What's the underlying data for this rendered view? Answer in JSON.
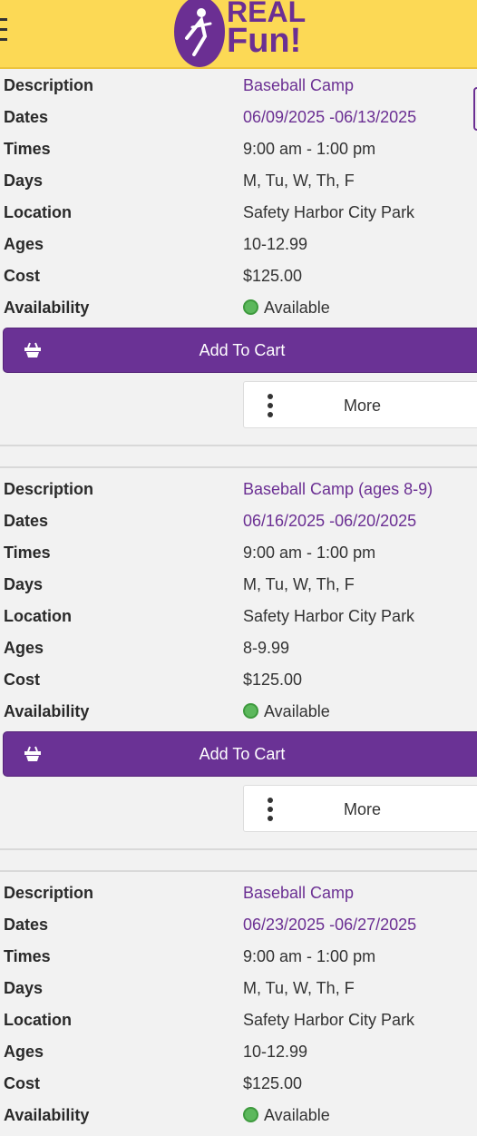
{
  "header": {
    "logo_real": "REAL",
    "logo_fun": "Fun!"
  },
  "labels": {
    "description": "Description",
    "dates": "Dates",
    "times": "Times",
    "days": "Days",
    "location": "Location",
    "ages": "Ages",
    "cost": "Cost",
    "availability": "Availability"
  },
  "buttons": {
    "add_to_cart": "Add To Cart",
    "more": "More"
  },
  "listings": [
    {
      "description": "Baseball Camp",
      "dates": "06/09/2025 -06/13/2025",
      "times": "9:00 am - 1:00 pm",
      "days": "M, Tu, W, Th, F",
      "location": "Safety Harbor City Park",
      "ages": "10-12.99",
      "cost": "$125.00",
      "availability": "Available"
    },
    {
      "description": "Baseball Camp (ages 8-9)",
      "dates": "06/16/2025 -06/20/2025",
      "times": "9:00 am - 1:00 pm",
      "days": "M, Tu, W, Th, F",
      "location": "Safety Harbor City Park",
      "ages": "8-9.99",
      "cost": "$125.00",
      "availability": "Available"
    },
    {
      "description": "Baseball Camp",
      "dates": "06/23/2025 -06/27/2025",
      "times": "9:00 am - 1:00 pm",
      "days": "M, Tu, W, Th, F",
      "location": "Safety Harbor City Park",
      "ages": "10-12.99",
      "cost": "$125.00",
      "availability": "Available"
    }
  ],
  "colors": {
    "header_bg": "#fcd955",
    "brand_purple": "#6b2f93",
    "available_green": "#5cb85c"
  },
  "icons": {
    "menu": "hamburger-menu-icon",
    "cart": "basket-icon",
    "more": "vertical-dots-icon",
    "status": "green-dot-icon"
  }
}
